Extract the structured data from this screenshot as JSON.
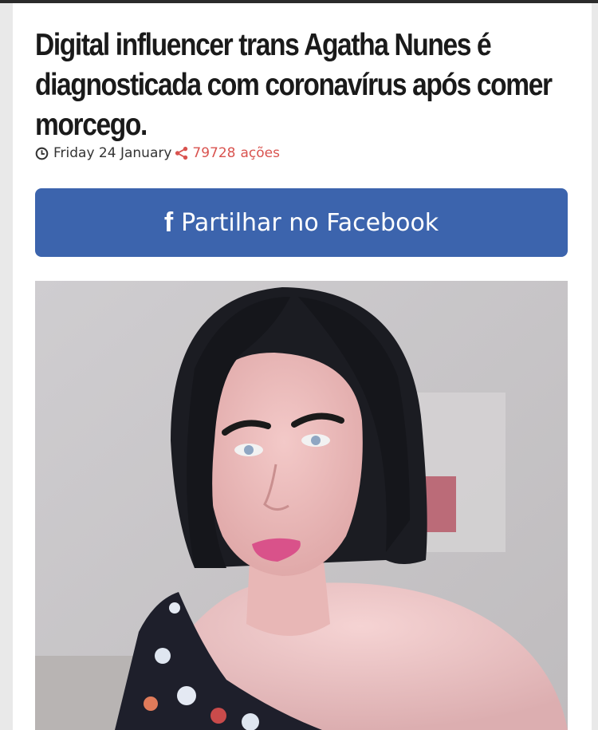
{
  "article": {
    "headline": "Digital influencer trans Agatha Nunes é diagnosticada com coronavírus após comer morcego.",
    "date": "Friday 24 January",
    "shares_count": "79728",
    "shares_label": "ações"
  },
  "share_button": {
    "icon_glyph": "f",
    "label": "Partilhar no Facebook"
  },
  "colors": {
    "facebook_blue": "#3c64ad",
    "shares_red": "#d9534f",
    "headline": "#1a1a1a"
  },
  "icons": {
    "clock": "clock-icon",
    "share": "share-icon",
    "facebook": "facebook-icon"
  }
}
